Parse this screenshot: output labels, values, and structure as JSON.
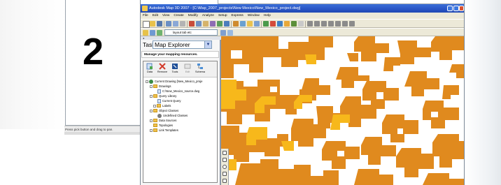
{
  "slide": {
    "number": "2"
  },
  "left_window": {
    "status_text": "Press pick button and drag to pan."
  },
  "app": {
    "title": "Autodesk Map 3D 2007 - [C:\\Map_2007_projects\\New Mexico\\New_Mexico_project.dwg]",
    "menu": [
      "File",
      "Edit",
      "View",
      "Create",
      "Modify",
      "Analyze",
      "Setup",
      "Express",
      "Window",
      "Help"
    ],
    "layer_combo": "layout tab etc"
  },
  "task_pane": {
    "task_label": "Task:",
    "task_value": "Map Explorer",
    "manage_title": "Manage your mapping resources.",
    "toolbar": [
      {
        "label": "Data",
        "icon": "data-icon"
      },
      {
        "label": "Remove",
        "icon": "remove-icon"
      },
      {
        "label": "Tools",
        "icon": "tools-icon"
      },
      {
        "label": "Edit",
        "icon": "edit-icon"
      },
      {
        "label": "Schema",
        "icon": "schema-icon"
      }
    ],
    "tree": [
      {
        "label": "Current Drawing [New_Mexico_proje",
        "icon": "globe-icon",
        "level": 0,
        "expander": "-"
      },
      {
        "label": "Drawings",
        "icon": "folder-icon",
        "level": 1,
        "expander": "-"
      },
      {
        "label": "C:\\New_Mexico_source.dwg",
        "icon": "drawing-icon",
        "level": 2,
        "expander": ""
      },
      {
        "label": "Query Library",
        "icon": "folder-icon",
        "level": 1,
        "expander": "-"
      },
      {
        "label": "Current Query",
        "icon": "query-icon",
        "level": 2,
        "expander": ""
      },
      {
        "label": "Labels",
        "icon": "folder-icon",
        "level": 2,
        "expander": "+"
      },
      {
        "label": "Object Classes",
        "icon": "folder-icon",
        "level": 1,
        "expander": "-"
      },
      {
        "label": "Undefined Classes",
        "icon": "class-icon",
        "level": 2,
        "expander": ""
      },
      {
        "label": "Data Sources",
        "icon": "folder-icon",
        "level": 1,
        "expander": "+"
      },
      {
        "label": "Topologies",
        "icon": "folder-icon",
        "level": 1,
        "expander": ""
      },
      {
        "label": "Link Templates",
        "icon": "folder-icon",
        "level": 1,
        "expander": "+"
      }
    ]
  },
  "map": {
    "colors": {
      "orange": "#e08a1e",
      "yellow": "#f7b81b",
      "background": "#ffffff"
    }
  }
}
